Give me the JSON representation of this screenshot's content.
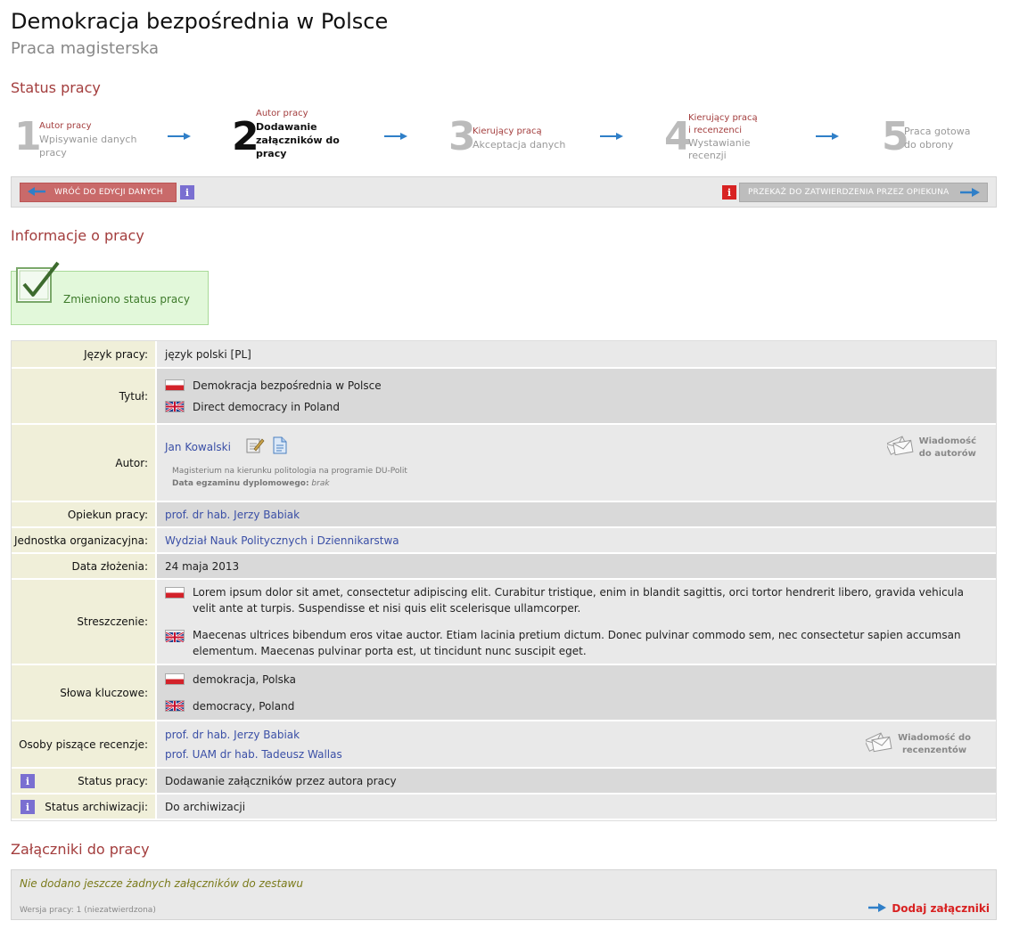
{
  "header": {
    "title": "Demokracja bezpośrednia w Polsce",
    "subtitle": "Praca magisterska"
  },
  "sections": {
    "status": "Status pracy",
    "info": "Informacje o pracy",
    "attachments": "Załączniki do pracy"
  },
  "steps": [
    {
      "num": "1",
      "actor": "Autor pracy",
      "desc": "Wpisywanie danych pracy"
    },
    {
      "num": "2",
      "actor": "Autor pracy",
      "desc": "Dodawanie załączników do pracy"
    },
    {
      "num": "3",
      "actor": "Kierujący pracą",
      "desc": "Akceptacja danych"
    },
    {
      "num": "4",
      "actor": "Kierujący pracą i recenzenci",
      "desc": "Wystawianie recenzji"
    },
    {
      "num": "5",
      "actor": "",
      "desc": "Praca gotowa do obrony"
    }
  ],
  "actions": {
    "back_label": "WRÓĆ DO EDYCJI DANYCH",
    "forward_label": "PRZEKAŻ DO ZATWIERDZENIA PRZEZ OPIEKUNA",
    "info_glyph": "i"
  },
  "success": {
    "message": "Zmieniono status pracy"
  },
  "info": {
    "language_label": "Język pracy:",
    "language_value": "język polski [PL]",
    "title_label": "Tytuł:",
    "title_pl": "Demokracja bezpośrednia w Polsce",
    "title_en": "Direct democracy in Poland",
    "author_label": "Autor:",
    "author_name": "Jan Kowalski",
    "author_program": "Magisterium na kierunku politologia na programie DU-Polit",
    "exam_label": "Data egzaminu dyplomowego:",
    "exam_value": "brak",
    "msg_authors_line1": "Wiadomość",
    "msg_authors_line2": "do autorów",
    "supervisor_label": "Opiekun pracy:",
    "supervisor_value": "prof. dr hab. Jerzy Babiak",
    "unit_label": "Jednostka organizacyjna:",
    "unit_value": "Wydział Nauk Politycznych i Dziennikarstwa",
    "date_label": "Data złożenia:",
    "date_value": "24 maja 2013",
    "abstract_label": "Streszczenie:",
    "abstract_pl": "Lorem ipsum dolor sit amet, consectetur adipiscing elit. Curabitur tristique, enim in blandit sagittis, orci tortor hendrerit libero, gravida vehicula velit ante at turpis. Suspendisse et nisi quis elit scelerisque ullamcorper.",
    "abstract_en": "Maecenas ultrices bibendum eros vitae auctor. Etiam lacinia pretium dictum. Donec pulvinar commodo sem, nec consectetur sapien accumsan elementum. Maecenas pulvinar porta est, ut tincidunt nunc suscipit eget.",
    "keywords_label": "Słowa kluczowe:",
    "keywords_pl": "demokracja, Polska",
    "keywords_en": "democracy, Poland",
    "reviewers_label": "Osoby piszące recenzje:",
    "reviewer_1": "prof. dr hab. Jerzy Babiak",
    "reviewer_2": "prof. UAM dr hab. Tadeusz Wallas",
    "msg_reviewers_line1": "Wiadomość do",
    "msg_reviewers_line2": "recenzentów",
    "status_label": "Status pracy:",
    "status_value": "Dodawanie załączników przez autora pracy",
    "archive_label": "Status archiwizacji:",
    "archive_value": "Do archiwizacji"
  },
  "attachments": {
    "empty_message": "Nie dodano jeszcze żadnych załączników do zestawu",
    "version": "Wersja pracy: 1 (niezatwierdzona)",
    "add_label": "Dodaj załączniki"
  },
  "colors": {
    "accent": "#a33d3d",
    "link": "#3a4fa6",
    "label_bg": "#f0efd9",
    "success_bg": "#e2f8da",
    "arrow_blue": "#2f7fc8"
  }
}
